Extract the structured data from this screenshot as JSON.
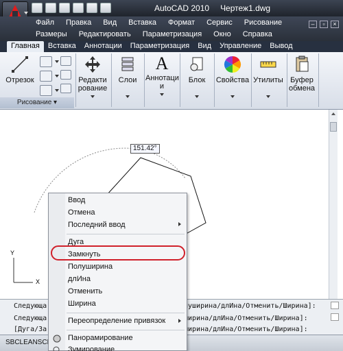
{
  "title": {
    "app": "AutoCAD 2010",
    "file": "Чертеж1.dwg"
  },
  "menu": {
    "row1": [
      "Файл",
      "Правка",
      "Вид",
      "Вставка",
      "Формат",
      "Сервис",
      "Рисование"
    ],
    "row2": [
      "Размеры",
      "Редактировать",
      "Параметризация",
      "Окно",
      "Справка"
    ]
  },
  "ribbon_tabs": [
    "Главная",
    "Вставка",
    "Аннотации",
    "Параметризация",
    "Вид",
    "Управление",
    "Вывод"
  ],
  "ribbon": {
    "line": "Отрезок",
    "group_draw": "Рисование",
    "edit_1": "Редакти",
    "edit_2": "рование",
    "layers": "Слои",
    "annot_1": "Аннотаци",
    "annot_2": "и",
    "block": "Блок",
    "props": "Свойства",
    "utils": "Утилиты",
    "clip_1": "Буфер",
    "clip_2": "обмена"
  },
  "canvas": {
    "angle": "151.42°"
  },
  "context_menu": {
    "items": [
      "Ввод",
      "Отмена",
      "Последний ввод",
      "Дуга",
      "Замкнуть",
      "Полуширина",
      "длИна",
      "Отменить",
      "Ширина",
      "Переопределение привязок",
      "Панорамирование",
      "Зумирование"
    ]
  },
  "command": {
    "line1_left": "Следующа",
    "line1_right": "пуширина/длИна/Отменить/Ширина]:",
    "line2_left": "Следующа",
    "line2_right": "ширина/длИна/Отменить/Ширина]:",
    "line3_left": "[Дуга/За",
    "line3_right": "ширина/длИна/Отменить/Ширина]:"
  },
  "status": {
    "text": "SBCLEANSCR"
  },
  "colors": {
    "highlight": "#d0202a",
    "titlebar": "#2a303a"
  }
}
